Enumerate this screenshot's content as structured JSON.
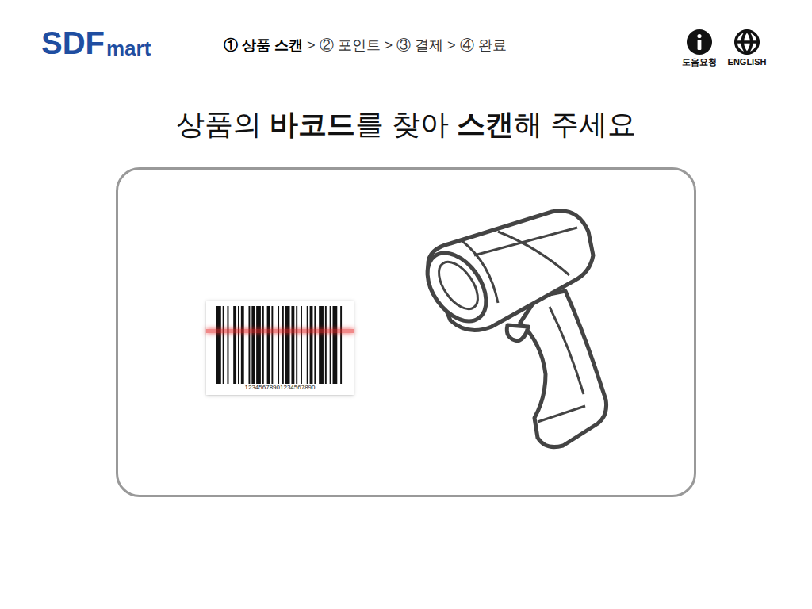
{
  "logo": {
    "main": "SDF",
    "sub": "mart"
  },
  "steps": [
    {
      "number": "①",
      "label": "상품 스캔",
      "selected": true
    },
    {
      "number": "②",
      "label": "포인트",
      "selected": false
    },
    {
      "number": "③",
      "label": "결제",
      "selected": false
    },
    {
      "number": "④",
      "label": "완료",
      "selected": false
    }
  ],
  "step_separator": ">",
  "header_buttons": [
    {
      "label": "도움요청",
      "kind": "info"
    },
    {
      "label": "ENGLISH",
      "kind": "language"
    }
  ],
  "title": [
    {
      "text": "상품의 ",
      "bold": false
    },
    {
      "text": "바코드",
      "bold": true
    },
    {
      "text": "를 찾아 ",
      "bold": false
    },
    {
      "text": "스캔",
      "bold": true
    },
    {
      "text": "해 주세요",
      "bold": false
    }
  ],
  "barcode": {
    "number": "12345678901234567890"
  }
}
